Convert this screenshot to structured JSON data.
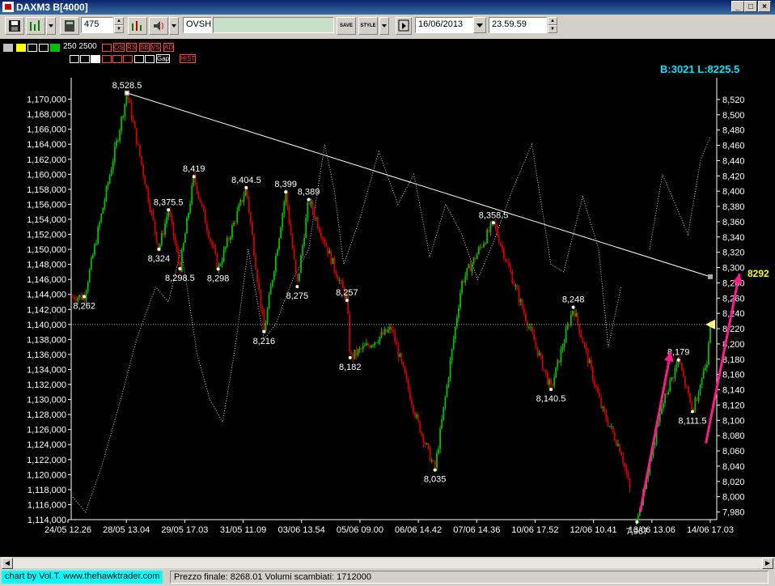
{
  "window": {
    "title": "DAXM3 B[4000]"
  },
  "toolbar": {
    "bars_value": "475",
    "symbol_value": "OVSH",
    "save_label": "SAVE",
    "style_label": "STYLE",
    "date_value": "16/06/2013",
    "time_value": "23.59.59"
  },
  "indicators": {
    "periods_label": "250 2500",
    "buttons": [
      "OS",
      "RS",
      "BB",
      "VS",
      "AD",
      "Gap",
      "HIST"
    ]
  },
  "header_info": "B:3021 L:8225.5",
  "status": {
    "credit": "chart by Vol.T. www.thehawktrader.com",
    "final_price_label": "Prezzo finale: 8268.01 Volumi scambiati: 1712000"
  },
  "colors": {
    "background": "#000000",
    "bull": "#00c000",
    "bear": "#d00000",
    "trendline": "#ffffff",
    "arrow": "#ff1a8c",
    "info": "#00ffff",
    "last_price": "#ffff00"
  },
  "chart_data": {
    "type": "candlestick",
    "left_axis": {
      "ylim": [
        1114000,
        1172000
      ],
      "ticks": [
        "1,114,000",
        "1,116,000",
        "1,118,000",
        "1,120,000",
        "1,122,000",
        "1,124,000",
        "1,126,000",
        "1,128,000",
        "1,130,000",
        "1,132,000",
        "1,134,000",
        "1,136,000",
        "1,138,000",
        "1,140,000",
        "1,142,000",
        "1,144,000",
        "1,146,000",
        "1,148,000",
        "1,150,000",
        "1,152,000",
        "1,154,000",
        "1,156,000",
        "1,158,000",
        "1,160,000",
        "1,162,000",
        "1,164,000",
        "1,166,000",
        "1,168,000",
        "1,170,000"
      ]
    },
    "right_axis": {
      "ylim": [
        7970,
        8540
      ],
      "ticks": [
        "7,980",
        "8,000",
        "8,020",
        "8,040",
        "8,060",
        "8,080",
        "8,100",
        "8,120",
        "8,140",
        "8,160",
        "8,180",
        "8,200",
        "8,220",
        "8,240",
        "8,260",
        "8,280",
        "8,300",
        "8,320",
        "8,340",
        "8,360",
        "8,380",
        "8,400",
        "8,420",
        "8,440",
        "8,460",
        "8,480",
        "8,500",
        "8,520"
      ]
    },
    "x_ticks": [
      "24/05 12.26",
      "28/05 13.04",
      "29/05 17.03",
      "31/05 11.09",
      "03/06 13.54",
      "05/06 09.00",
      "06/06 14.42",
      "07/06 14.36",
      "10/06 17.52",
      "12/06 10.41",
      "13/06 13.06",
      "14/06 17.03"
    ],
    "price_path": [
      [
        0.0,
        8262
      ],
      [
        0.018,
        8262
      ],
      [
        0.085,
        8528.5
      ],
      [
        0.135,
        8324
      ],
      [
        0.15,
        8375.5
      ],
      [
        0.168,
        8298.5
      ],
      [
        0.19,
        8419
      ],
      [
        0.228,
        8298
      ],
      [
        0.272,
        8404.5
      ],
      [
        0.3,
        8216
      ],
      [
        0.334,
        8399
      ],
      [
        0.352,
        8275
      ],
      [
        0.37,
        8389
      ],
      [
        0.43,
        8257
      ],
      [
        0.435,
        8182
      ],
      [
        0.5,
        8220
      ],
      [
        0.54,
        8100
      ],
      [
        0.568,
        8035
      ],
      [
        0.61,
        8280
      ],
      [
        0.66,
        8358.5
      ],
      [
        0.7,
        8260
      ],
      [
        0.75,
        8140.5
      ],
      [
        0.785,
        8248
      ],
      [
        0.83,
        8115
      ],
      [
        0.86,
        8060
      ],
      [
        0.885,
        7967
      ],
      [
        0.925,
        8120
      ],
      [
        0.95,
        8179
      ],
      [
        0.972,
        8111.5
      ],
      [
        0.995,
        8180
      ],
      [
        1.0,
        8235
      ]
    ],
    "overlay_path": [
      [
        0.0,
        1117000
      ],
      [
        0.02,
        1115000
      ],
      [
        0.045,
        1121000
      ],
      [
        0.075,
        1130000
      ],
      [
        0.1,
        1138000
      ],
      [
        0.13,
        1145000
      ],
      [
        0.15,
        1143000
      ],
      [
        0.17,
        1150000
      ],
      [
        0.195,
        1136000
      ],
      [
        0.215,
        1130000
      ],
      [
        0.235,
        1127000
      ],
      [
        0.255,
        1137000
      ],
      [
        0.275,
        1150000
      ],
      [
        0.3,
        1138000
      ],
      [
        0.318,
        1140000
      ],
      [
        0.345,
        1146000
      ],
      [
        0.37,
        1150000
      ],
      [
        0.395,
        1164000
      ],
      [
        0.41,
        1158000
      ],
      [
        0.425,
        1148000
      ],
      [
        0.45,
        1154000
      ],
      [
        0.48,
        1163000
      ],
      [
        0.51,
        1156000
      ],
      [
        0.535,
        1160000
      ],
      [
        0.56,
        1149000
      ],
      [
        0.585,
        1156000
      ],
      [
        0.61,
        1152000
      ],
      [
        0.635,
        1146000
      ],
      [
        0.66,
        1151000
      ],
      [
        0.69,
        1158000
      ],
      [
        0.72,
        1164000
      ],
      [
        0.75,
        1148000
      ],
      [
        0.77,
        1147000
      ],
      [
        0.8,
        1157000
      ],
      [
        0.825,
        1150000
      ],
      [
        0.84,
        1137000
      ],
      [
        0.86,
        1145000
      ],
      [
        0.88,
        1138000
      ],
      [
        0.905,
        1150000
      ],
      [
        0.925,
        1160000
      ],
      [
        0.945,
        1156000
      ],
      [
        0.965,
        1152000
      ],
      [
        0.985,
        1162000
      ],
      [
        1.0,
        1165000
      ]
    ],
    "overlay_breaks": [
      [
        0.875,
        0.885
      ]
    ],
    "labels": [
      {
        "text": "8,528.5",
        "t": 0.085,
        "price": 8528.5,
        "pos": "above"
      },
      {
        "text": "8,262",
        "t": 0.018,
        "price": 8262,
        "pos": "below"
      },
      {
        "text": "8,324",
        "t": 0.135,
        "price": 8324,
        "pos": "below"
      },
      {
        "text": "8,375.5",
        "t": 0.15,
        "price": 8375.5,
        "pos": "above"
      },
      {
        "text": "8,298.5",
        "t": 0.168,
        "price": 8298.5,
        "pos": "below"
      },
      {
        "text": "8,419",
        "t": 0.19,
        "price": 8419,
        "pos": "above"
      },
      {
        "text": "8,298",
        "t": 0.228,
        "price": 8298,
        "pos": "below"
      },
      {
        "text": "8,404.5",
        "t": 0.272,
        "price": 8404.5,
        "pos": "above"
      },
      {
        "text": "8,216",
        "t": 0.3,
        "price": 8216,
        "pos": "below"
      },
      {
        "text": "8,399",
        "t": 0.334,
        "price": 8399,
        "pos": "above"
      },
      {
        "text": "8,275",
        "t": 0.352,
        "price": 8275,
        "pos": "below"
      },
      {
        "text": "8,389",
        "t": 0.37,
        "price": 8389,
        "pos": "above"
      },
      {
        "text": "8,257",
        "t": 0.43,
        "price": 8257,
        "pos": "above"
      },
      {
        "text": "8,182",
        "t": 0.435,
        "price": 8182,
        "pos": "below"
      },
      {
        "text": "8,035",
        "t": 0.568,
        "price": 8035,
        "pos": "below"
      },
      {
        "text": "8,358.5",
        "t": 0.66,
        "price": 8358.5,
        "pos": "above"
      },
      {
        "text": "8,140.5",
        "t": 0.75,
        "price": 8140.5,
        "pos": "below"
      },
      {
        "text": "8,248",
        "t": 0.785,
        "price": 8248,
        "pos": "above"
      },
      {
        "text": "7,967",
        "t": 0.885,
        "price": 7967,
        "pos": "below"
      },
      {
        "text": "8,179",
        "t": 0.95,
        "price": 8179,
        "pos": "above"
      },
      {
        "text": "8,111.5",
        "t": 0.972,
        "price": 8111.5,
        "pos": "below"
      }
    ],
    "trendline": [
      [
        0.085,
        8528.5
      ],
      [
        1.0,
        8288
      ]
    ],
    "hline": 8225.5,
    "last_price_label": "8292",
    "gaps": [
      [
        0.875,
        0.882
      ]
    ],
    "arrows": [
      {
        "from": [
          0.885,
          7980
        ],
        "to": [
          0.938,
          8190
        ]
      },
      {
        "from": [
          0.988,
          8070
        ],
        "to": [
          1.0,
          8292
        ]
      }
    ]
  }
}
